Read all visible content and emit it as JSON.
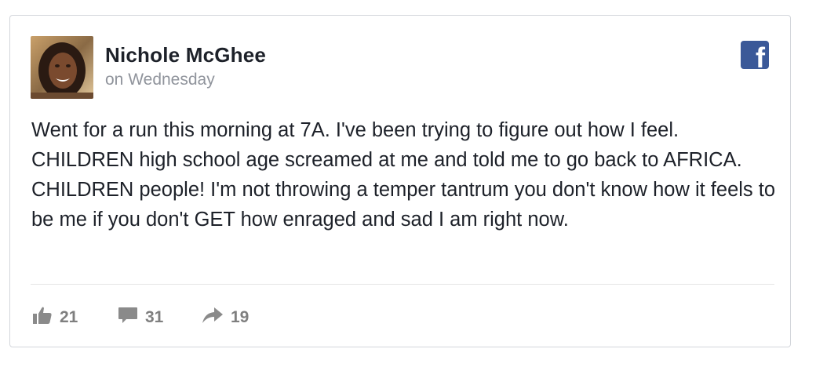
{
  "post": {
    "author": {
      "name": "Nichole McGhee",
      "avatar_icon": "profile-photo"
    },
    "time": "on Wednesday",
    "platform_icon": "facebook-icon",
    "platform_color": "#3b5998",
    "text": "Went for a run this morning at 7A. I've been trying to figure out how I feel. CHILDREN high school age screamed at me and told me to go back to AFRICA. CHILDREN people! I'm not throwing a temper tantrum you don't know how it feels to be me if you don't GET how enraged and sad I am right now.",
    "stats": {
      "likes": "21",
      "comments": "31",
      "shares": "19"
    }
  }
}
